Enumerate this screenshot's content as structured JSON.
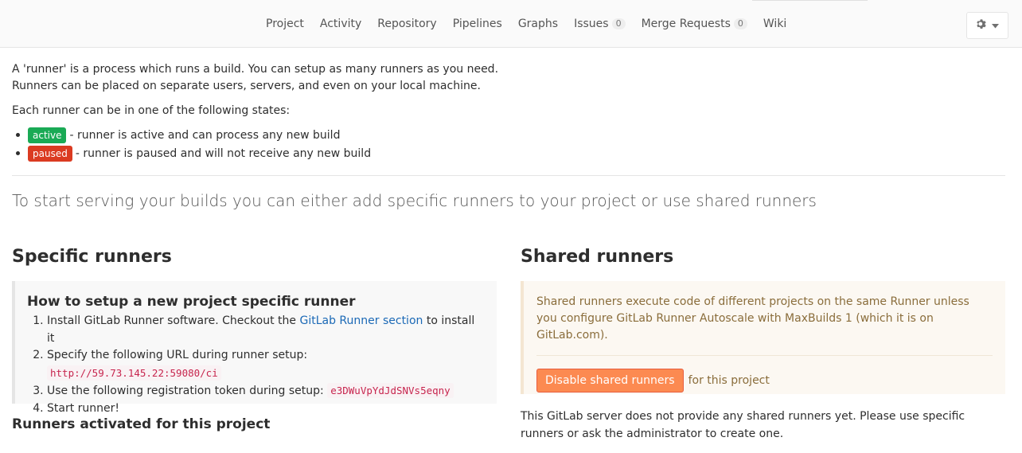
{
  "nav": {
    "items": [
      {
        "label": "Project"
      },
      {
        "label": "Activity"
      },
      {
        "label": "Repository"
      },
      {
        "label": "Pipelines"
      },
      {
        "label": "Graphs"
      },
      {
        "label": "Issues",
        "count": "0"
      },
      {
        "label": "Merge Requests",
        "count": "0"
      },
      {
        "label": "Wiki"
      }
    ],
    "settings_icon": "gear-icon"
  },
  "intro": {
    "line1": "A 'runner' is a process which runs a build. You can setup as many runners as you need.",
    "line2": "Runners can be placed on separate users, servers, and even on your local machine."
  },
  "states": {
    "label": "Each runner can be in one of the following states:",
    "items": [
      {
        "badge": "active",
        "text": "- runner is active and can process any new build"
      },
      {
        "badge": "paused",
        "text": "- runner is paused and will not receive any new build"
      }
    ]
  },
  "lead": "To start serving your builds you can either add specific runners to your project or use shared runners",
  "specific": {
    "title": "Specific runners",
    "howto_title": "How to setup a new project specific runner",
    "step1_prefix": "Install GitLab Runner software. Checkout the",
    "step1_link": "GitLab Runner section",
    "step1_suffix": "to install it",
    "step2_prefix": "Specify the following URL during runner setup:",
    "step2_code": "http://59.73.145.22:59080/ci",
    "step3_prefix": "Use the following registration token during setup:",
    "step3_code": "e3DWuVpYdJdSNVs5eqny",
    "step4": "Start runner!",
    "activated_title": "Runners activated for this project"
  },
  "shared": {
    "title": "Shared runners",
    "info": "Shared runners execute code of different projects on the same Runner unless you configure GitLab Runner Autoscale with MaxBuilds 1 (which it is on GitLab.com).",
    "disable_button": "Disable shared runners",
    "disable_suffix": "for this project",
    "note": "This GitLab server does not provide any shared runners yet. Please use specific runners or ask the administrator to create one."
  },
  "colors": {
    "active_badge": "#1aaa55",
    "paused_badge": "#db3b21",
    "warning_button": "#fc8a51",
    "link": "#1b69b6"
  }
}
